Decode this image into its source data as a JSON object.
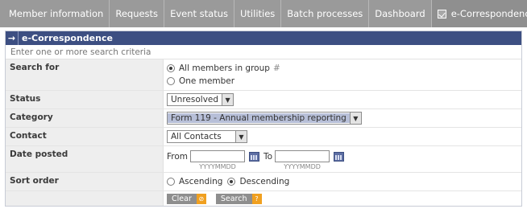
{
  "nav": {
    "items": [
      "Member information",
      "Requests",
      "Event status",
      "Utilities",
      "Batch processes",
      "Dashboard"
    ],
    "active_label": "e-Correspondence",
    "active_icon": "checkmark-icon"
  },
  "panel": {
    "title": "e-Correspondence",
    "arrow": "→",
    "hint": "Enter one or more search criteria"
  },
  "form": {
    "search_for": {
      "label": "Search for",
      "option_group": "All members in group",
      "group_suffix": "#",
      "option_one": "One member",
      "selected": "group"
    },
    "status": {
      "label": "Status",
      "value": "Unresolved"
    },
    "category": {
      "label": "Category",
      "value": "Form 119 - Annual membership reporting"
    },
    "contact": {
      "label": "Contact",
      "value": "All Contacts"
    },
    "date_posted": {
      "label": "Date posted",
      "from_label": "From",
      "to_label": "To",
      "from_value": "",
      "to_value": "",
      "format_hint": "YYYYMMDD"
    },
    "sort_order": {
      "label": "Sort order",
      "option_asc": "Ascending",
      "option_desc": "Descending",
      "selected": "desc"
    }
  },
  "buttons": {
    "clear_label": "Clear",
    "clear_icon": "⊘",
    "search_label": "Search",
    "search_icon": "?"
  },
  "colors": {
    "nav_bg": "#9a9a9a",
    "header_bg": "#3d4f82",
    "label_bg": "#eeeeee",
    "button_accent": "#f0a020"
  }
}
